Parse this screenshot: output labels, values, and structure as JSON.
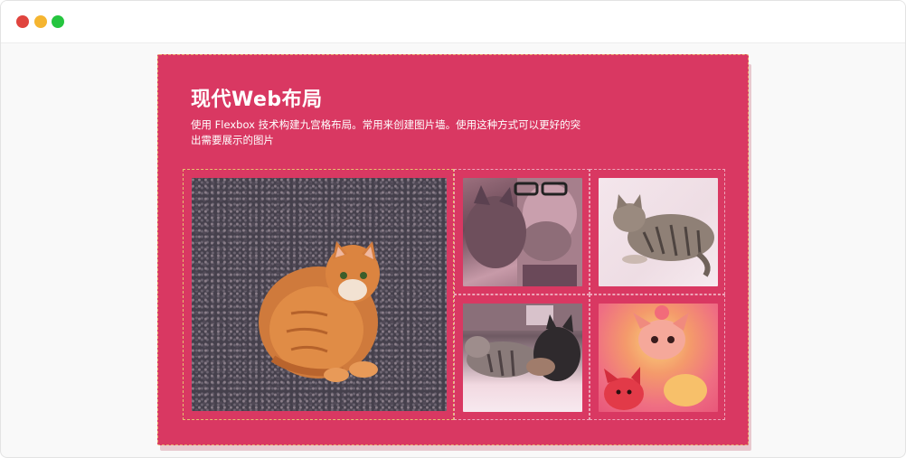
{
  "window": {
    "controls": [
      {
        "name": "close",
        "color": "#e0443e"
      },
      {
        "name": "minimize",
        "color": "#f5b530"
      },
      {
        "name": "maximize",
        "color": "#25c53f"
      }
    ]
  },
  "card": {
    "background": "#d93862",
    "title": "现代Web布局",
    "description": "使用 Flexbox 技术构建九宫格布局。常用来创建图片墙。使用这种方式可以更好的突出需要展示的图片"
  },
  "gallery": {
    "photos": [
      {
        "id": "orange-cat"
      },
      {
        "id": "man-with-cat"
      },
      {
        "id": "tabby-cat"
      },
      {
        "id": "two-cats"
      },
      {
        "id": "pink-kittens"
      }
    ]
  }
}
